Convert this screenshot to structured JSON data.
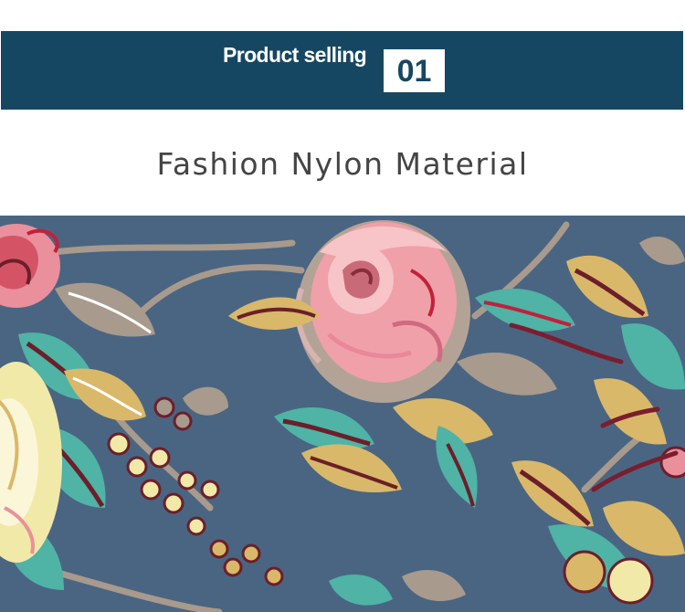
{
  "banner": {
    "label": "Product selling",
    "number": "01",
    "color": "#164762"
  },
  "subtitle": "Fashion Nylon Material",
  "fabric_photo": {
    "description": "floral-print-nylon-fabric",
    "colors": {
      "background": "#4a6582",
      "rose_pink": "#f0a0a8",
      "leaf_teal": "#4fb3a6",
      "leaf_gold": "#d9b86a",
      "maroon": "#6b1f2a",
      "taupe": "#a89a8c"
    }
  }
}
